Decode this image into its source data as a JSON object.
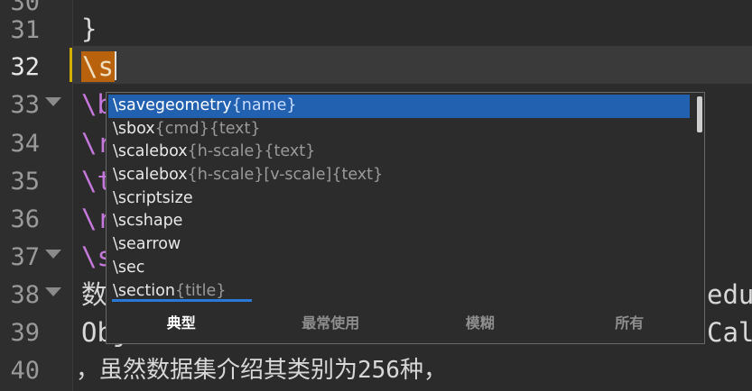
{
  "gutter": {
    "lines": [
      "30",
      "31",
      "32",
      "33",
      "34",
      "35",
      "36",
      "37",
      "38",
      "39",
      "40"
    ],
    "current": "32"
  },
  "code": {
    "line31": "}",
    "line32_typed": "\\s",
    "line33": "\\b",
    "line34": "\\r",
    "line35": "\\t",
    "line36": "\\r",
    "line37": "\\s",
    "line38_prefix": "数",
    "line38_suffix": "edu/",
    "line39_prefix": "Obj",
    "line39_suffix": "Calte",
    "line40": "，虽然数据集介绍其类别为256种，"
  },
  "autocomplete": {
    "items": [
      {
        "cmd": "\\savegeometry",
        "args": "{name}"
      },
      {
        "cmd": "\\sbox",
        "args": "{cmd}{text}"
      },
      {
        "cmd": "\\scalebox",
        "args": "{h-scale}{text}"
      },
      {
        "cmd": "\\scalebox",
        "args": "{h-scale}[v-scale]{text}"
      },
      {
        "cmd": "\\scriptsize",
        "args": ""
      },
      {
        "cmd": "\\scshape",
        "args": ""
      },
      {
        "cmd": "\\searrow",
        "args": ""
      },
      {
        "cmd": "\\sec",
        "args": ""
      },
      {
        "cmd": "\\section",
        "args": "{title}"
      }
    ],
    "selected_index": 0,
    "tabs": [
      "典型",
      "最常使用",
      "模糊",
      "所有"
    ],
    "active_tab": "典型"
  },
  "colors": {
    "selection": "#2260b0",
    "current_line_marker": "#d4b000",
    "typed_highlight": "#b8620e",
    "tab_underline": "#2a78d6"
  }
}
